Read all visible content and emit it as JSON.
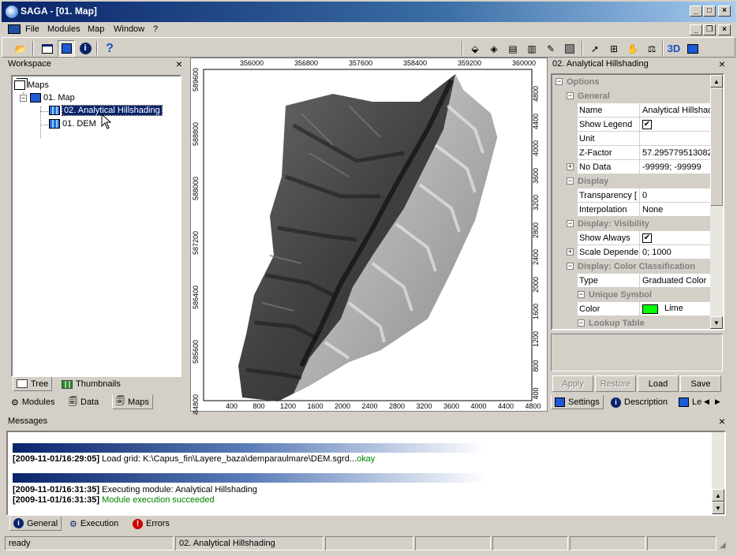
{
  "window": {
    "title": "SAGA - [01. Map]",
    "controls": {
      "minimize": "_",
      "maximize": "□",
      "close": "×"
    }
  },
  "menubar": {
    "items": [
      "File",
      "Modules",
      "Map",
      "Window",
      "?"
    ]
  },
  "workspace": {
    "title": "Workspace",
    "tree": {
      "root": "Maps",
      "map": "01. Map",
      "layers": [
        "02. Analytical Hillshading",
        "01. DEM"
      ]
    },
    "view_tabs": [
      "Tree",
      "Thumbnails"
    ],
    "bottom_tabs": [
      "Modules",
      "Data",
      "Maps"
    ]
  },
  "map": {
    "top_ticks": [
      "356000",
      "356800",
      "357600",
      "358400",
      "359200",
      "360000"
    ],
    "bottom_ticks": [
      "400",
      "800",
      "1200",
      "1600",
      "2000",
      "2400",
      "2800",
      "3200",
      "3600",
      "4000",
      "4400",
      "4800"
    ],
    "left_ticks": [
      "589600",
      "588800",
      "588000",
      "587200",
      "586400",
      "585600",
      "584800"
    ],
    "right_ticks": [
      "4800",
      "4400",
      "4000",
      "3600",
      "3200",
      "2800",
      "2400",
      "2000",
      "1600",
      "1200",
      "800",
      "400"
    ]
  },
  "properties": {
    "title": "02. Analytical Hillshading",
    "rows": [
      {
        "kind": "cat",
        "level": 0,
        "label": "Options",
        "box": "−"
      },
      {
        "kind": "cat",
        "level": 1,
        "label": "General",
        "box": "−"
      },
      {
        "kind": "prop",
        "name": "Name",
        "value": "Analytical Hillshadi"
      },
      {
        "kind": "prop",
        "name": "Show Legend",
        "check": "✔"
      },
      {
        "kind": "prop",
        "name": "Unit",
        "value": ""
      },
      {
        "kind": "prop",
        "name": "Z-Factor",
        "value": "57.295779513082"
      },
      {
        "kind": "prop",
        "name": "No Data",
        "value": "-99999; -99999",
        "box": "+"
      },
      {
        "kind": "cat",
        "level": 1,
        "label": "Display",
        "box": "−"
      },
      {
        "kind": "prop",
        "name": "Transparency [",
        "value": "0"
      },
      {
        "kind": "prop",
        "name": "Interpolation",
        "value": "None"
      },
      {
        "kind": "cat",
        "level": 1,
        "label": "Display: Visibility",
        "box": "−"
      },
      {
        "kind": "prop",
        "name": "Show Always",
        "check": "✔"
      },
      {
        "kind": "prop",
        "name": "Scale Depender",
        "value": "0; 1000",
        "box": "+"
      },
      {
        "kind": "cat",
        "level": 1,
        "label": "Display: Color Classification",
        "box": "−"
      },
      {
        "kind": "prop",
        "name": "Type",
        "value": "Graduated Color"
      },
      {
        "kind": "cat",
        "level": 2,
        "label": "Unique Symbol",
        "box": "−"
      },
      {
        "kind": "prop",
        "name": "Color",
        "value": "Lime",
        "swatch": "#00ff00"
      },
      {
        "kind": "cat",
        "level": 2,
        "label": "Lookup Table",
        "box": "−"
      }
    ],
    "buttons": {
      "apply": "Apply",
      "restore": "Restore",
      "load": "Load",
      "save": "Save"
    },
    "tabs": [
      "Settings",
      "Description",
      "Le"
    ]
  },
  "messages": {
    "title": "Messages",
    "lines": [
      {
        "ts": "[2009-11-01/16:29:05]",
        "text": " Load grid: K:\\Capus_fin\\Layere_baza\\demparaulmare\\DEM.sgrd...",
        "extra": "okay"
      },
      {
        "ts": "[2009-11-01/16:31:35]",
        "text": " Executing module: Analytical Hillshading",
        "extra": ""
      },
      {
        "ts": "[2009-11-01/16:31:35]",
        "text": "",
        "extra": " Module execution succeeded"
      }
    ],
    "tabs": [
      "General",
      "Execution",
      "Errors"
    ]
  },
  "status": {
    "ready": "ready",
    "layer": "02. Analytical Hillshading"
  },
  "colors": {
    "accent": "#0a246a",
    "ok_green": "#008000",
    "swatch": "#00ff00"
  }
}
